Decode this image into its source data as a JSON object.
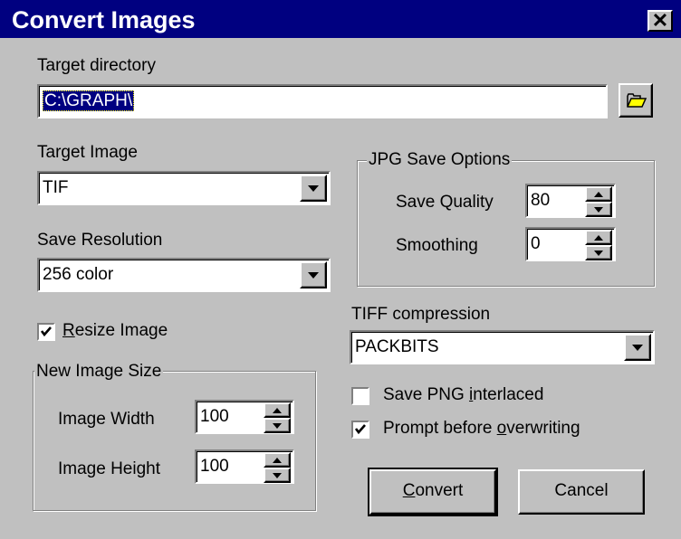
{
  "window": {
    "title": "Convert Images",
    "close_glyph": "✕"
  },
  "target_directory": {
    "label": "Target directory",
    "value": "C:\\GRAPH\\"
  },
  "target_image": {
    "label": "Target Image",
    "value": "TIF"
  },
  "save_resolution": {
    "label": "Save Resolution",
    "value": "256 color"
  },
  "resize_image": {
    "label_first": "R",
    "label_rest": "esize Image",
    "checked": true
  },
  "new_image_size": {
    "title": "New Image Size",
    "width_label": "Image Width",
    "width_value": "100",
    "height_label": "Image Height",
    "height_value": "100"
  },
  "jpg_options": {
    "title": "JPG Save Options",
    "quality_label": "Save Quality",
    "quality_value": "80",
    "smoothing_label": "Smoothing",
    "smoothing_value": "0"
  },
  "tiff_compression": {
    "label": "TIFF compression",
    "value": "PACKBITS"
  },
  "png_interlaced": {
    "label_pre": "Save PNG ",
    "label_u": "i",
    "label_post": "nterlaced",
    "checked": false
  },
  "prompt_overwrite": {
    "label_pre": "Prompt before ",
    "label_u": "o",
    "label_post": "verwriting",
    "checked": true
  },
  "buttons": {
    "convert_u": "C",
    "convert_rest": "onvert",
    "cancel": "Cancel"
  },
  "colors": {
    "title_bar": "#000080",
    "face": "#c0c0c0",
    "selection": "#000080"
  },
  "icons": {
    "browse": "folder-icon",
    "dropdown": "chevron-down-icon",
    "spin_up": "spin-up-icon",
    "spin_down": "spin-down-icon"
  }
}
